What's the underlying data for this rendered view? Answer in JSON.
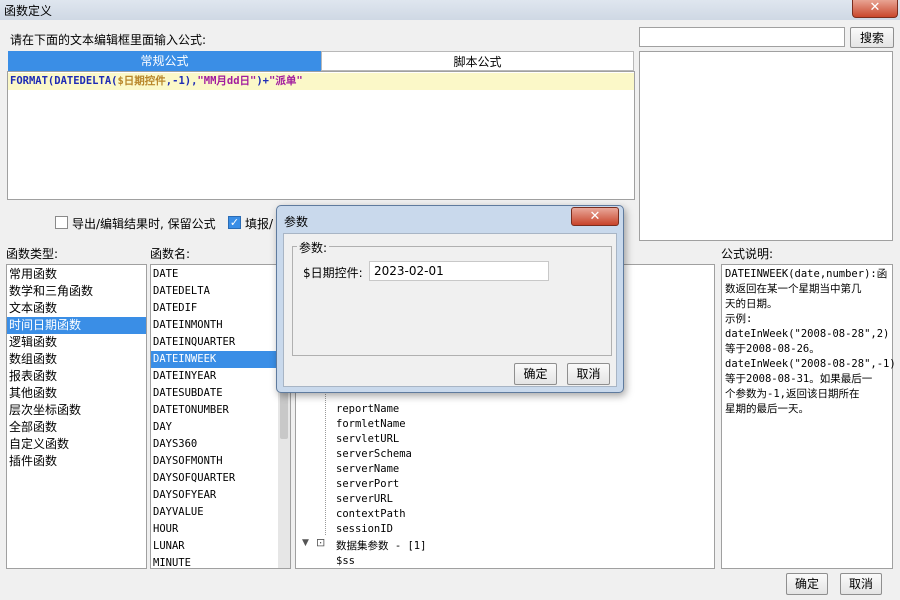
{
  "window": {
    "title": "函数定义",
    "close_glyph": "✕"
  },
  "editor": {
    "prompt": "请在下面的文本编辑框里面输入公式:",
    "tabs": [
      "常规公式",
      "脚本公式"
    ],
    "formula_parts": [
      {
        "text": "FORMAT(DATEDELTA(",
        "color": "#1d2bb5"
      },
      {
        "text": "$日期控件",
        "color": "#b8862b"
      },
      {
        "text": ",-1)",
        "color": "#1d2bb5"
      },
      {
        "text": ",",
        "color": "#1d2bb5"
      },
      {
        "text": "\"MM月dd日\"",
        "color": "#a21c9e"
      },
      {
        "text": ")+",
        "color": "#1d2bb5"
      },
      {
        "text": "\"派单\"",
        "color": "#a21c9e"
      }
    ]
  },
  "search": {
    "value": "",
    "button": "搜索"
  },
  "options": {
    "keep_formula": {
      "label": "导出/编辑结果时, 保留公式",
      "checked": false
    },
    "fill_option": {
      "label": "填报/",
      "checked": true
    }
  },
  "function_types": {
    "header": "函数类型:",
    "items": [
      "常用函数",
      "数学和三角函数",
      "文本函数",
      "时间日期函数",
      "逻辑函数",
      "数组函数",
      "报表函数",
      "其他函数",
      "层次坐标函数",
      "全部函数",
      "自定义函数",
      "插件函数"
    ],
    "selected": 3
  },
  "function_names": {
    "header": "函数名:",
    "items": [
      "DATE",
      "DATEDELTA",
      "DATEDIF",
      "DATEINMONTH",
      "DATEINQUARTER",
      "DATEINWEEK",
      "DATEINYEAR",
      "DATESUBDATE",
      "DATETONUMBER",
      "DAY",
      "DAYS360",
      "DAYSOFMONTH",
      "DAYSOFQUARTER",
      "DAYSOFYEAR",
      "DAYVALUE",
      "HOUR",
      "LUNAR",
      "MINUTE"
    ],
    "selected": 5
  },
  "params_tree": {
    "items": [
      "reportName",
      "formletName",
      "servletURL",
      "serverSchema",
      "serverName",
      "serverPort",
      "serverURL",
      "contextPath",
      "sessionID"
    ],
    "group_label": "数据集参数 - [1]",
    "group_item": "$ss"
  },
  "description": {
    "header": "公式说明:",
    "lines": [
      "DATEINWEEK(date,number):函",
      "数返回在某一个星期当中第几",
      "天的日期。",
      "示例:",
      "dateInWeek(\"2008-08-28\",2)",
      "等于2008-08-26。",
      "dateInWeek(\"2008-08-28\",-1)",
      "等于2008-08-31。如果最后一",
      "个参数为-1,返回该日期所在",
      "星期的最后一天。"
    ]
  },
  "footer": {
    "ok": "确定",
    "cancel": "取消"
  },
  "dialog": {
    "title": "参数",
    "close_glyph": "✕",
    "group_label": "参数:",
    "field_label": "$日期控件:",
    "field_value": "2023-02-01",
    "ok": "确定",
    "cancel": "取消"
  }
}
